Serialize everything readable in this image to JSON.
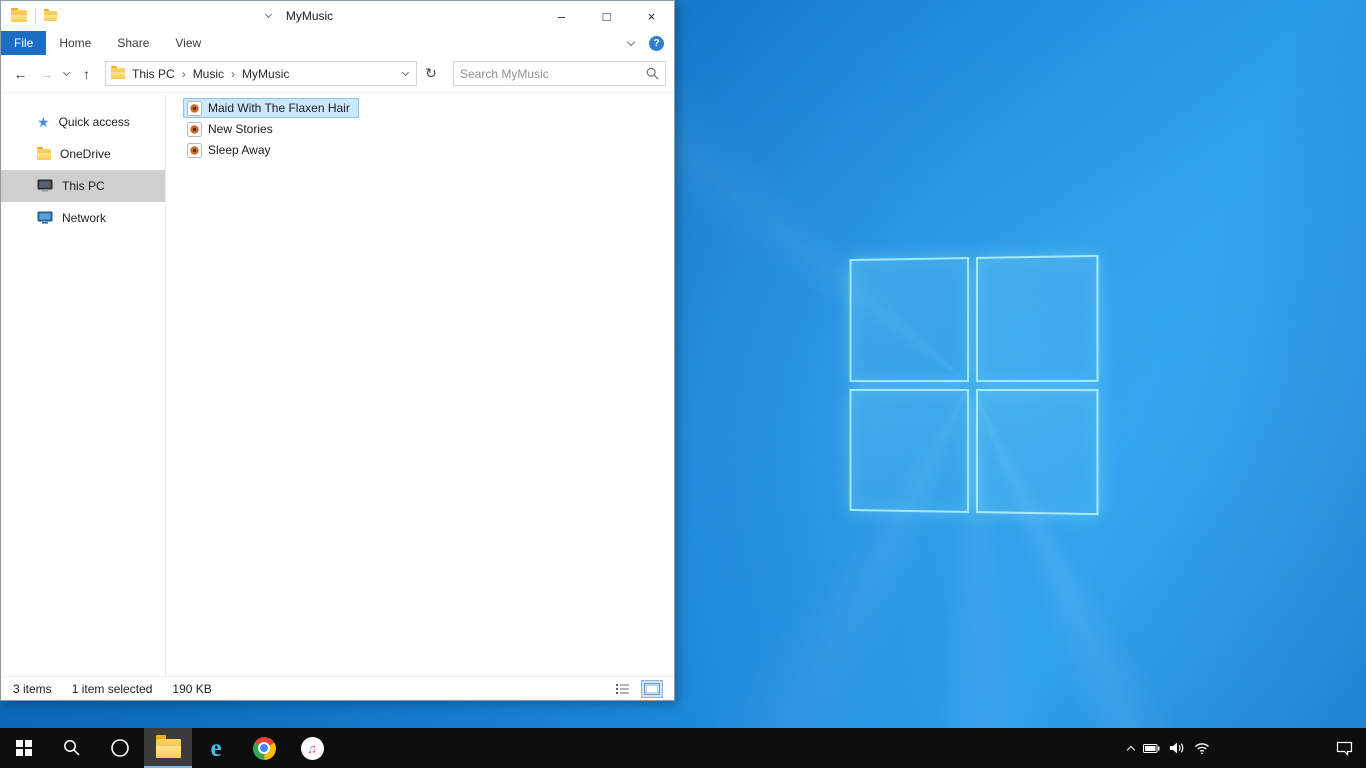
{
  "icons": {
    "minimize": "–",
    "maximize": "□",
    "close": "×",
    "help": "?",
    "back_arrow": "←",
    "forward_arrow": "→",
    "up_arrow": "↑",
    "refresh": "↻",
    "breadcrumb_separator": "›",
    "quick_access_star": "★",
    "ie": "e",
    "itunes_note": "♫"
  },
  "explorer": {
    "title": "MyMusic",
    "ribbon": {
      "tabs": [
        {
          "label": "File",
          "active": true
        },
        {
          "label": "Home",
          "active": false
        },
        {
          "label": "Share",
          "active": false
        },
        {
          "label": "View",
          "active": false
        }
      ]
    },
    "address": {
      "crumbs": [
        "This PC",
        "Music",
        "MyMusic"
      ]
    },
    "search": {
      "placeholder": "Search MyMusic"
    },
    "sidebar": {
      "items": [
        {
          "label": "Quick access",
          "icon": "star-icon"
        },
        {
          "label": "OneDrive",
          "icon": "folder-icon"
        },
        {
          "label": "This PC",
          "icon": "computer-icon",
          "selected": true
        },
        {
          "label": "Network",
          "icon": "network-icon"
        }
      ]
    },
    "files": [
      {
        "name": "Maid With The Flaxen Hair",
        "selected": true
      },
      {
        "name": "New Stories",
        "selected": false
      },
      {
        "name": "Sleep Away",
        "selected": false
      }
    ],
    "status": {
      "count": "3 items",
      "selected": "1 item selected",
      "size": "190 KB"
    }
  },
  "colors": {
    "file_tab_blue": "#1b6ec2",
    "selection_blue": "#cce8ff",
    "sidebar_selected_gray": "#cfcfcf",
    "taskbar_black": "#0d0d0d",
    "wallpaper_blue": "#1a85d8"
  }
}
